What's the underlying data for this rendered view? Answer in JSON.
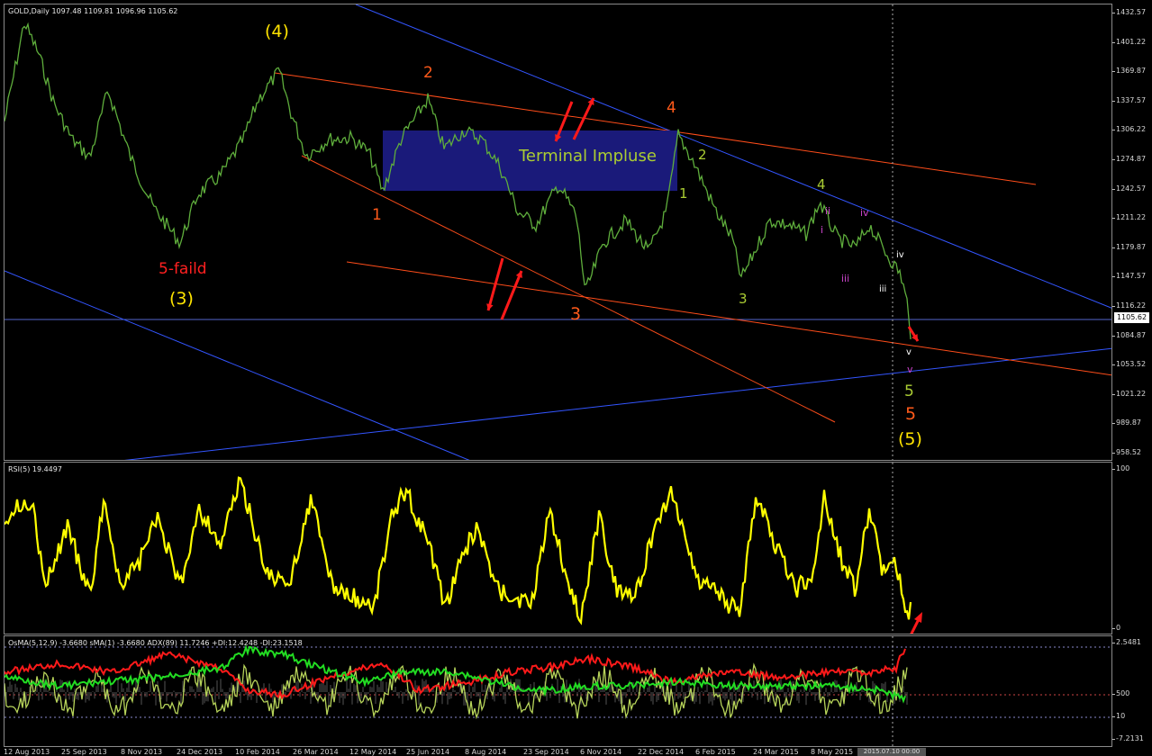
{
  "price_pane": {
    "title": "GOLD,Daily 1097.48 1109.81 1096.96 1105.62",
    "current_price": "1105.62",
    "ticks": [
      "1432.57",
      "1401.22",
      "1369.87",
      "1337.57",
      "1306.22",
      "1274.87",
      "1242.57",
      "1211.22",
      "1179.87",
      "1147.57",
      "1116.22",
      "1084.87",
      "1053.52",
      "1021.22",
      "989.87",
      "958.52"
    ],
    "labels": {
      "w4_major": "(4)",
      "w3_major": "(3)",
      "failed": "5-faild",
      "w5_major": "(5)",
      "red_1": "1",
      "red_2": "2",
      "red_3": "3",
      "red_4": "4",
      "red_5": "5",
      "terminal": "Terminal Impluse",
      "green_1": "1",
      "green_2": "2",
      "green_3": "3",
      "green_4": "4",
      "green_5": "5",
      "pur_i": "i",
      "pur_ii": "ii",
      "pur_iii": "iii",
      "pur_iv": "iv",
      "pur_v": "v",
      "wh_iii": "iii",
      "wh_iv": "iv",
      "wh_v": "v"
    }
  },
  "rsi_pane": {
    "title": "RSI(5) 19.4497",
    "ticks": [
      "100",
      "0"
    ]
  },
  "osma_pane": {
    "title": "OsMA(5,12,9) -3.6680  sMA(1) -3.6680  ADX(89) 11.7246  +DI:12.4248  -DI:23.1518",
    "ticks": [
      "2.5481",
      "500",
      "10",
      "-7.2131"
    ]
  },
  "date_axis": {
    "dates": [
      "12 Aug 2013",
      "25 Sep 2013",
      "8 Nov 2013",
      "24 Dec 2013",
      "10 Feb 2014",
      "26 Mar 2014",
      "12 May 2014",
      "25 Jun 2014",
      "8 Aug 2014",
      "23 Sep 2014",
      "6 Nov 2014",
      "22 Dec 2014",
      "6 Feb 2015",
      "24 Mar 2015",
      "8 May 2015"
    ],
    "cursor_date": "2015.07.10 00:00"
  },
  "colors": {
    "price_line": "#5fae3c",
    "rsi_line": "#ffff00",
    "adx_green": "#22dd22",
    "di_red": "#ff1a1a",
    "osma_hist": "#b7d45a",
    "trend_red": "#ff4d1a",
    "trend_blue": "#3355ff",
    "box": "#1a1a7a",
    "label_yellow": "#ffe400",
    "label_orange": "#ff5a1a",
    "label_green": "#aacc33",
    "label_purple": "#cc44cc"
  }
}
